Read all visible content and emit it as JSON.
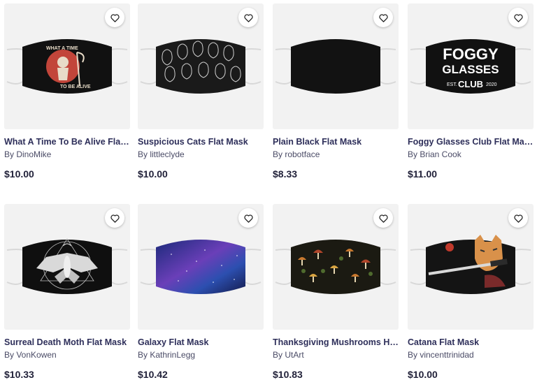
{
  "products": [
    {
      "title": "What A Time To Be Alive Flat ...",
      "artist": "By DinoMike",
      "price": "$10.00",
      "design_text_top": "WHAT A TIME",
      "design_text_bottom": "TO BE ALIVE",
      "color": "#111111"
    },
    {
      "title": "Suspicious Cats Flat Mask",
      "artist": "By littleclyde",
      "price": "$10.00",
      "color": "#1a1a1a"
    },
    {
      "title": "Plain Black Flat Mask",
      "artist": "By robotface",
      "price": "$8.33",
      "color": "#121212"
    },
    {
      "title": "Foggy Glasses Club Flat Mask",
      "artist": "By Brian Cook",
      "price": "$11.00",
      "design_text_1": "FOGGY",
      "design_text_2": "GLASSES",
      "design_text_3": "EST.",
      "design_text_4": "CLUB",
      "design_text_5": "2020",
      "color": "#111111"
    },
    {
      "title": "Surreal Death Moth Flat Mask",
      "artist": "By VonKowen",
      "price": "$10.33",
      "color": "#0f0f0f"
    },
    {
      "title": "Galaxy Flat Mask",
      "artist": "By KathrinLegg",
      "price": "$10.42",
      "color": "#3b2a8a"
    },
    {
      "title": "Thanksgiving Mushrooms Har...",
      "artist": "By UtArt",
      "price": "$10.83",
      "color": "#1b1a12"
    },
    {
      "title": "Catana Flat Mask",
      "artist": "By vincenttrinidad",
      "price": "$10.00",
      "color": "#141414"
    }
  ],
  "icons": {
    "favorite": "heart-outline-icon"
  }
}
